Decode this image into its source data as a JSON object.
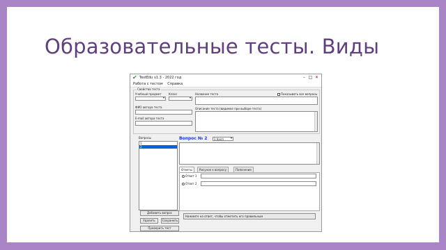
{
  "slide": {
    "title": "Образовательные тесты. Виды"
  },
  "window": {
    "title": "TestEdu v1.3 - 2022 год",
    "menu": [
      "Работа с тестом",
      "Справка"
    ],
    "group_caption": "Свойства теста",
    "labels": {
      "subject": "Учебный предмет",
      "class": "Класс",
      "test_name": "Название теста",
      "author_fio": "ФИО автора теста",
      "author_email": "E-mail автора теста",
      "test_desc": "Описание теста (видимое при выборе теста)",
      "questions": "Вопросы",
      "show_all": "Показывать все вопросы"
    },
    "question_items": [
      "1",
      "2"
    ],
    "buttons": {
      "add_question": "Добавить вопрос",
      "delete": "Удалить",
      "save": "Сохранить",
      "test_check": "Проверить тест"
    },
    "question_header": "Вопрос № 2",
    "question_type": "1 балл",
    "tabs": [
      "Ответы",
      "Рисунок к вопросу",
      "Пояснение"
    ],
    "answer_rows": [
      "Ответ 1",
      "Ответ 2"
    ],
    "status_text": "Нажмите на ответ, чтобы отметить его правильным"
  }
}
